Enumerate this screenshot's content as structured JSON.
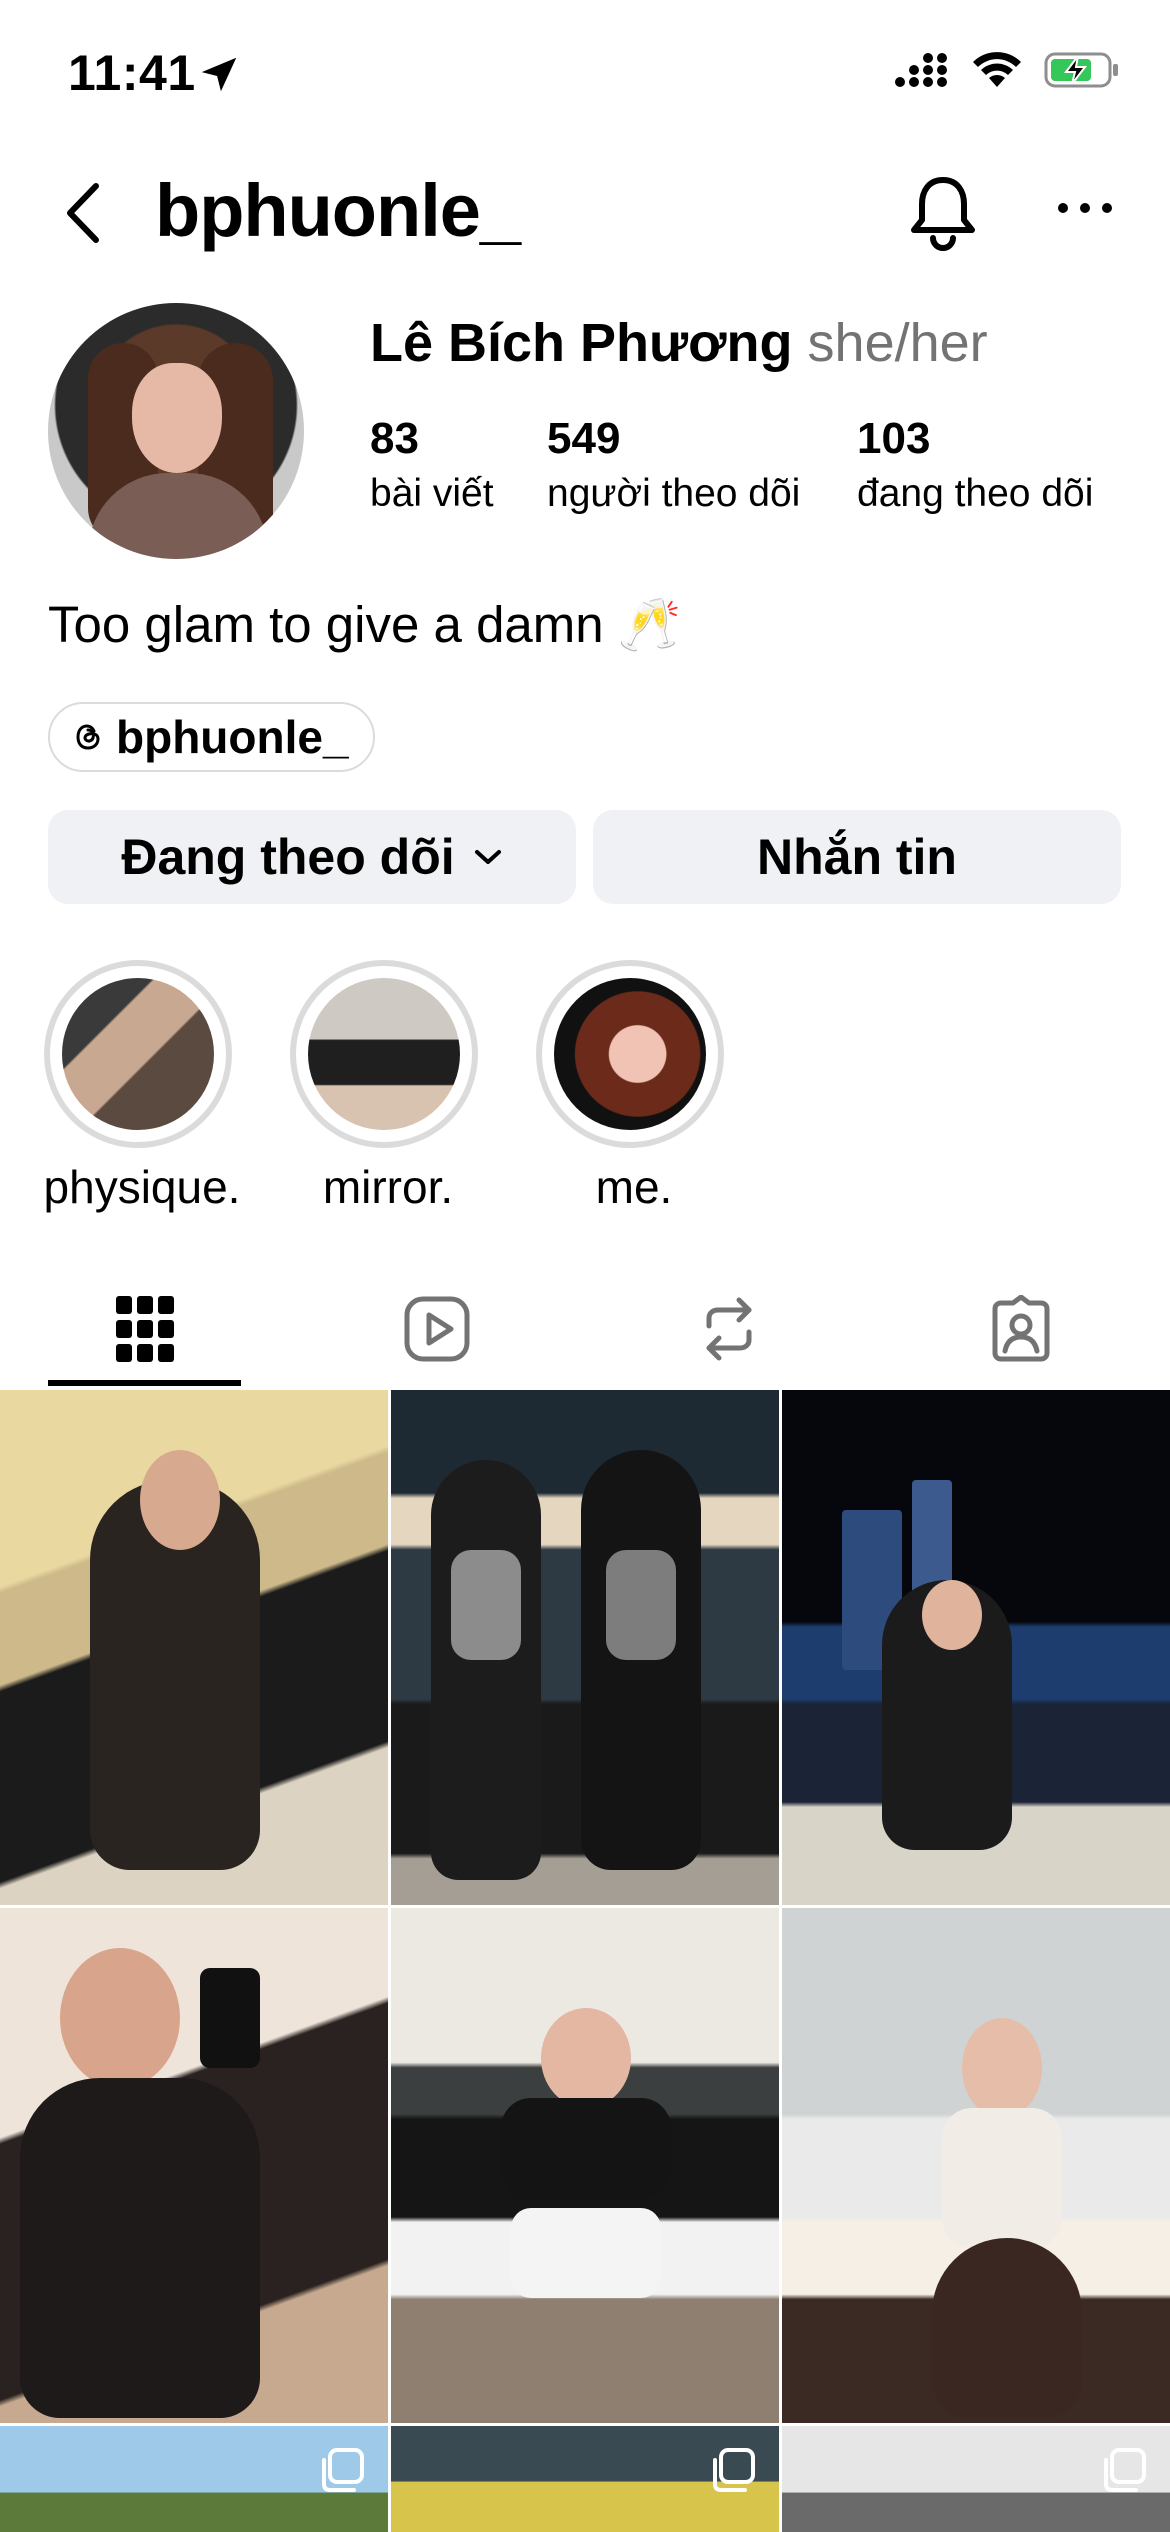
{
  "status_bar": {
    "time": "11:41",
    "icons": [
      "location-arrow-icon",
      "cellular-signal-icon",
      "wifi-icon",
      "battery-charging-icon"
    ]
  },
  "header": {
    "username": "bphuonle_",
    "icons": [
      "back-icon",
      "bell-icon",
      "more-icon"
    ]
  },
  "profile": {
    "full_name": "Lê Bích Phương",
    "pronouns": "she/her",
    "stats": [
      {
        "value": "83",
        "label": "bài viết"
      },
      {
        "value": "549",
        "label": "người theo dõi"
      },
      {
        "value": "103",
        "label": "đang theo dõi"
      }
    ],
    "bio": "Too glam to give a damn 🥂",
    "threads_handle": "bphuonle_"
  },
  "actions": {
    "follow_label": "Đang theo dõi",
    "message_label": "Nhắn tin"
  },
  "highlights": [
    {
      "label": "physique."
    },
    {
      "label": "mirror."
    },
    {
      "label": "me."
    }
  ],
  "tabs": [
    {
      "icon": "grid-icon",
      "selected": true
    },
    {
      "icon": "reels-icon",
      "selected": false
    },
    {
      "icon": "reposts-icon",
      "selected": false
    },
    {
      "icon": "tagged-icon",
      "selected": false
    }
  ],
  "colors": {
    "secondary_text": "#737373",
    "button_bg": "#eff1f4",
    "divider": "#dbdbdb"
  }
}
